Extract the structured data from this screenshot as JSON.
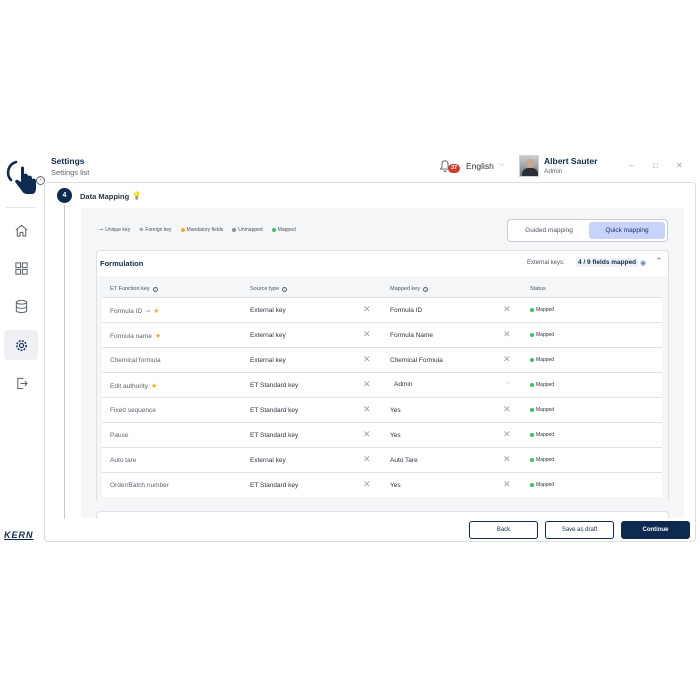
{
  "header": {
    "title": "Settings",
    "subtitle": "Settings list",
    "notifications_count": "37",
    "language": "English",
    "user_name": "Albert Sauter",
    "user_role": "Admin",
    "minimize": "–",
    "maximize": "□",
    "close": "✕"
  },
  "sidebar": {
    "brand": "KERN",
    "items": [
      {
        "icon": "home-icon"
      },
      {
        "icon": "grid-icon"
      },
      {
        "icon": "database-icon"
      },
      {
        "icon": "gear-icon",
        "active": true
      },
      {
        "icon": "logout-icon"
      }
    ]
  },
  "step": {
    "number": "4",
    "title": "Data Mapping"
  },
  "legend": {
    "unique_key": "Unique key",
    "foreign_key": "Foreign key",
    "mandatory": "Mandatory fields",
    "unmapped": "Unmapped",
    "mapped": "Mapped"
  },
  "mapping_toggle": {
    "guided": "Guided mapping",
    "quick": "Quick mapping"
  },
  "section": {
    "title": "Formulation",
    "external_keys_label": "External keys:",
    "external_keys_count": "4 / 9 fields mapped"
  },
  "columns": {
    "function_key": "ET Function key",
    "source_type": "Source type",
    "mapped_key": "Mapped key",
    "status": "Status"
  },
  "rows": [
    {
      "function_key": "Formula ID",
      "source_type": "External key",
      "mapped_key": "Formula ID",
      "status": "Mapped"
    },
    {
      "function_key": "Formula name",
      "source_type": "External key",
      "mapped_key": "Formula Name",
      "status": "Mapped"
    },
    {
      "function_key": "Chemical formula",
      "source_type": "External key",
      "mapped_key": "Chemical Formula",
      "status": "Mapped"
    },
    {
      "function_key": "Edit authority",
      "source_type": "ET Standard key",
      "mapped_key": "Admin",
      "status": "Mapped"
    },
    {
      "function_key": "Fixed sequence",
      "source_type": "ET Standard key",
      "mapped_key": "Yes",
      "status": "Mapped"
    },
    {
      "function_key": "Pause",
      "source_type": "ET Standard key",
      "mapped_key": "Yes",
      "status": "Mapped"
    },
    {
      "function_key": "Auto tare",
      "source_type": "External key",
      "mapped_key": "Auto Tare",
      "status": "Mapped"
    },
    {
      "function_key": "Order/Batch number",
      "source_type": "ET Standard key",
      "mapped_key": "Yes",
      "status": "Mapped"
    }
  ],
  "footer": {
    "back": "Back",
    "save_draft": "Save as draft",
    "continue": "Continue"
  },
  "colors": {
    "primary": "#0e2a4f",
    "accent": "#c7d3fb",
    "mapped": "#3fbf6a",
    "unmapped": "#8c939c",
    "mandatory": "#f2b01e",
    "badge": "#d63b30"
  }
}
